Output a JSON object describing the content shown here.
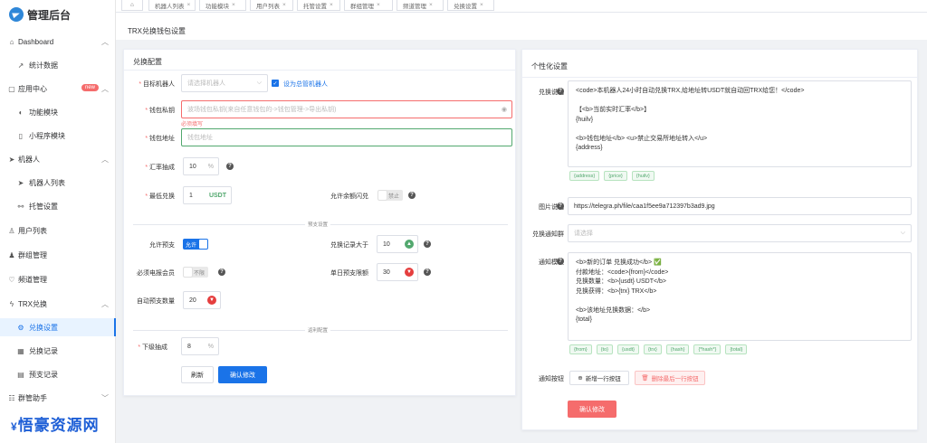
{
  "app": {
    "title": "管理后台"
  },
  "sidebar": {
    "items": [
      {
        "label": "Dashboard",
        "icon": "home-icon",
        "arrow": "chevron-up"
      },
      {
        "label": "统计数据",
        "icon": "chart-line-icon"
      },
      {
        "label": "应用中心",
        "icon": "box-icon",
        "badge": "new",
        "arrow": "chevron-up"
      },
      {
        "label": "功能模块",
        "icon": "toggle-icon"
      },
      {
        "label": "小程序模块",
        "icon": "phone-icon"
      },
      {
        "label": "机器人",
        "icon": "send-icon",
        "arrow": "chevron-up"
      },
      {
        "label": "机器人列表",
        "icon": "send-icon"
      },
      {
        "label": "托管设置",
        "icon": "link-icon"
      },
      {
        "label": "用户列表",
        "icon": "user-icon"
      },
      {
        "label": "群组管理",
        "icon": "users-icon"
      },
      {
        "label": "频道管理",
        "icon": "heart-icon"
      },
      {
        "label": "TRX兑换",
        "icon": "bolt-icon",
        "arrow": "chevron-up"
      },
      {
        "label": "兑换设置",
        "icon": "gear-icon",
        "active": true
      },
      {
        "label": "兑换记录",
        "icon": "table-icon"
      },
      {
        "label": "预支记录",
        "icon": "document-icon"
      },
      {
        "label": "群管助手",
        "icon": "chat-icon",
        "arrow": "chevron-down"
      }
    ],
    "watermark": {
      "prefix": "¥",
      "text": "悟豪资源网"
    }
  },
  "tabs": [
    {
      "label": "机器人列表"
    },
    {
      "label": "功能模块"
    },
    {
      "label": "用户列表"
    },
    {
      "label": "托管设置"
    },
    {
      "label": "群组管理"
    },
    {
      "label": "频道管理"
    },
    {
      "label": "兑换设置"
    }
  ],
  "page": {
    "title": "TRX兑换钱包设置"
  },
  "exchange": {
    "title": "兑换配置",
    "target_robot": {
      "label": "目标机器人",
      "placeholder": "请选择机器人",
      "checkbox": "设为总管机器人"
    },
    "wallet_key": {
      "label": "钱包私钥",
      "placeholder": "波场钱包私钥(来自任意钱包的->钱包管理->导出私钥)",
      "error": "必须填写"
    },
    "wallet_address": {
      "label": "钱包地址",
      "placeholder": "钱包地址"
    },
    "exchange_fee": {
      "label": "汇率抽成",
      "value": "10",
      "suffix": "%"
    },
    "min_exchange": {
      "label": "最低兑换",
      "value": "1",
      "suffix": "USDT"
    },
    "allow_balance": {
      "label": "允许余额闪兑",
      "state": "禁止"
    },
    "divider_prepay": "预支设置",
    "allow_prepay": {
      "label": "允许预支",
      "state": "允许"
    },
    "records_gt": {
      "label": "兑换记录大于",
      "value": "10"
    },
    "need_member": {
      "label": "必须电报会员",
      "state": "不限"
    },
    "daily_limit": {
      "label": "单日预支限额",
      "value": "30"
    },
    "auto_prepay": {
      "label": "自动预支数量",
      "value": "20"
    },
    "divider_invite": "返利配置",
    "sub_fee": {
      "label": "下级抽成",
      "value": "8",
      "suffix": "%"
    },
    "reset_btn": "刷新",
    "confirm_btn": "确认修改"
  },
  "custom": {
    "title": "个性化设置",
    "desc": {
      "label": "兑换说明",
      "lines": [
        "<code>本机器人24小时自动兑换TRX,给地址转USDT就自动回TRX给您！</code>",
        "",
        "【<b>当前实时汇率</b>】",
        "{huilv}",
        "",
        "<b>钱包地址</b> <u>禁止交易所地址转入</u>",
        "{address}"
      ],
      "tags": [
        "{address}",
        "{price}",
        "{huilv}"
      ]
    },
    "image": {
      "label": "图片说明",
      "value": "https://telegra.ph/file/caa1f5ee9a712397b3ad9.jpg"
    },
    "notify_group": {
      "label": "兑换通知群",
      "placeholder": "请选择"
    },
    "notify_tpl": {
      "label": "通知模板",
      "lines": [
        "<b>新的订单 兑换成功</b> ✅",
        "付款地址：<code>{from}</code>",
        "兑换数量：<b>{usdt} USDT</b>",
        "兑换获得：<b>{trx} TRX</b>",
        "",
        "<b>该地址兑换数据：</b>",
        "{total}"
      ],
      "tags": [
        "{from}",
        "{to}",
        "{usdt}",
        "{trx}",
        "{hash}",
        "{*hash*}",
        "{total}"
      ]
    },
    "notify_btn": {
      "label": "通知按钮",
      "add": "新增一行按钮",
      "del": "删除最后一行按钮"
    },
    "confirm_btn": "确认修改"
  },
  "colors": {
    "primary": "#1a73e8",
    "danger": "#f56c6c",
    "success": "#52a86e"
  }
}
